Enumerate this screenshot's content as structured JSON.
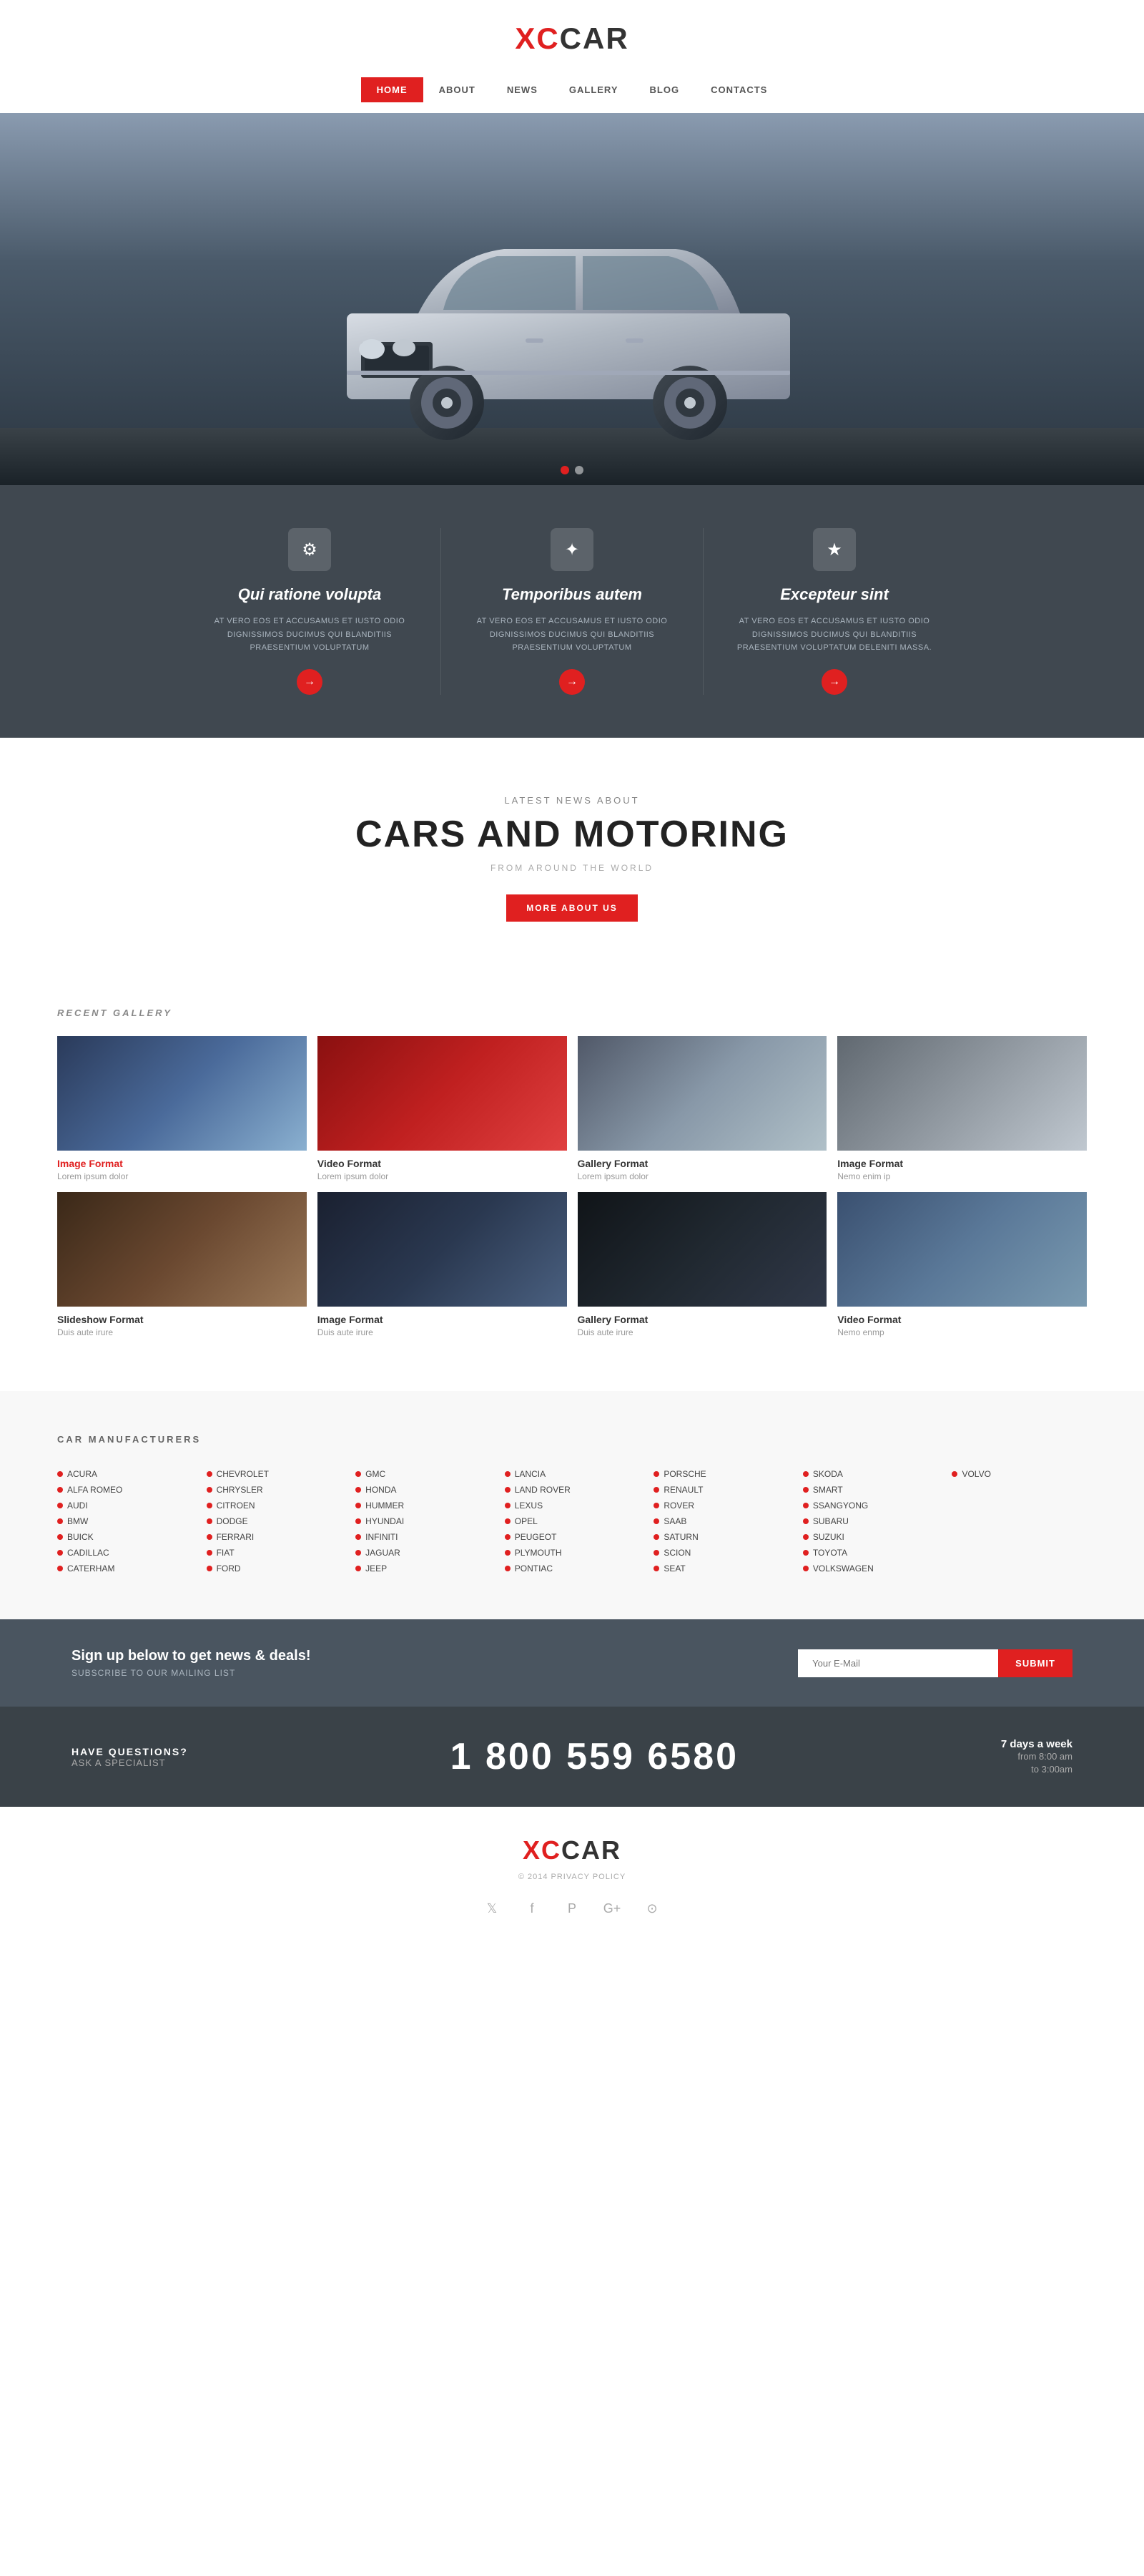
{
  "header": {
    "logo_xc": "XC",
    "logo_car": "CAR"
  },
  "nav": {
    "items": [
      {
        "label": "HOME",
        "active": true
      },
      {
        "label": "ABOUT",
        "active": false
      },
      {
        "label": "NEWS",
        "active": false
      },
      {
        "label": "GALLERY",
        "active": false
      },
      {
        "label": "BLOG",
        "active": false
      },
      {
        "label": "CONTACTS",
        "active": false
      }
    ]
  },
  "hero": {
    "dots": 2
  },
  "features": {
    "items": [
      {
        "icon": "⚙",
        "title": "Qui ratione volupta",
        "desc": "AT VERO EOS ET ACCUSAMUS ET IUSTO ODIO DIGNISSIMOS DUCIMUS QUI BLANDITIIS PRAESENTIUM VOLUPTATUM"
      },
      {
        "icon": "✦",
        "title": "Temporibus autem",
        "desc": "AT VERO EOS ET ACCUSAMUS ET IUSTO ODIO DIGNISSIMOS DUCIMUS QUI BLANDITIIS PRAESENTIUM VOLUPTATUM"
      },
      {
        "icon": "★",
        "title": "Excepteur sint",
        "desc": "AT VERO EOS ET ACCUSAMUS ET IUSTO ODIO DIGNISSIMOS DUCIMUS QUI BLANDITIIS PRAESENTIUM VOLUPTATUM DELENITI MASSA."
      }
    ]
  },
  "news": {
    "subtitle": "LATEST NEWS ABOUT",
    "title": "CARS AND MOTORING",
    "from": "FROM AROUND THE WORLD",
    "btn": "MORE ABOUT US"
  },
  "gallery": {
    "section_title": "RECENT GALLERY",
    "items": [
      {
        "format": "Image Format",
        "caption": "Lorem ipsum dolor",
        "color": "car-blue",
        "red": true
      },
      {
        "format": "Video Format",
        "caption": "Lorem ipsum dolor",
        "color": "car-red",
        "red": false
      },
      {
        "format": "Gallery Format",
        "caption": "Lorem ipsum dolor",
        "color": "car-silver",
        "red": false
      },
      {
        "format": "Image Format",
        "caption": "Nemo enim ip",
        "color": "car-silver2",
        "red": false
      },
      {
        "format": "Slideshow Format",
        "caption": "Duis aute irure",
        "color": "car-brown",
        "red": false
      },
      {
        "format": "Image Format",
        "caption": "Duis aute irure",
        "color": "car-darkblue",
        "red": false
      },
      {
        "format": "Gallery Format",
        "caption": "Duis aute irure",
        "color": "car-black",
        "red": false
      },
      {
        "format": "Video Format",
        "caption": "Nemo enmp",
        "color": "car-blue2",
        "red": false
      }
    ]
  },
  "manufacturers": {
    "section_title": "CAR MANUFACTURERS",
    "items": [
      "ACURA",
      "ALFA ROMEO",
      "AUDI",
      "BMW",
      "BUICK",
      "CADILLAC",
      "CATERHAM",
      "CHEVROLET",
      "CHRYSLER",
      "CITROEN",
      "DODGE",
      "FERRARI",
      "FIAT",
      "FORD",
      "GMC",
      "HONDA",
      "HUMMER",
      "HYUNDAI",
      "INFINITI",
      "JAGUAR",
      "JEEP",
      "LANCIA",
      "LAND ROVER",
      "LEXUS",
      "OPEL",
      "PEUGEOT",
      "PLYMOUTH",
      "PONTIAC",
      "PORSCHE",
      "RENAULT",
      "ROVER",
      "SAAB",
      "SATURN",
      "SCION",
      "SEAT",
      "SKODA",
      "SMART",
      "SSANGYONG",
      "SUBARU",
      "SUZUKI",
      "TOYOTA",
      "VOLKSWAGEN",
      "VOLVO"
    ]
  },
  "signup": {
    "heading": "Sign up below to get news & deals!",
    "subtext": "SUBSCRIBE TO OUR MAILING LIST",
    "placeholder": "Your E-Mail",
    "btn": "submit"
  },
  "contact": {
    "label1": "HAVE QUESTIONS?",
    "label2": "ASK A SPECIALIST",
    "phone": "1 800 559 6580",
    "hours1": "7 days a week",
    "hours2": "from 8:00 am",
    "hours3": "to 3:00am"
  },
  "footer": {
    "logo_xc": "XC",
    "logo_car": "CAR",
    "copyright": "© 2014  PRIVACY POLICY",
    "social": [
      "twitter",
      "facebook",
      "pinterest",
      "google-plus",
      "github"
    ]
  }
}
